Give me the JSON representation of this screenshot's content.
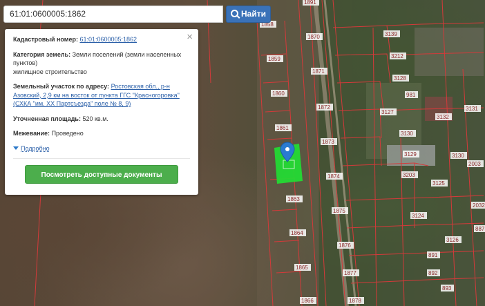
{
  "search": {
    "value": "61:01:0600005:1862",
    "button_label": "Найти"
  },
  "info_panel": {
    "cadastral": {
      "label": "Кадастровый номер:",
      "value": "61:01:0600005:1862"
    },
    "category": {
      "label": "Категория земель:",
      "value": "Земли поселений (земли населенных пунктов)",
      "use": "жилищное строительство"
    },
    "address": {
      "label": "Земельный участок по адресу:",
      "value": "Ростовская обл., р-н Азовский, 2,9 км на восток от пункта ГГС \"Красногоровка\" (СХКА \"им. XX Партсъезда\" поле № 8, 9)"
    },
    "area": {
      "label": "Уточненная площадь:",
      "value": "520 кв.м."
    },
    "survey": {
      "label": "Межевание:",
      "value": "Проведено"
    },
    "more_label": "Подробно",
    "docs_button": "Посмотреть доступные документы"
  },
  "map": {
    "selected_color": "#22dd33",
    "marker_color": "#2a7bd0",
    "plot_labels": [
      "1891",
      "1858",
      "1859",
      "1860",
      "1861",
      "1863",
      "1864",
      "1865",
      "1866",
      "1870",
      "1871",
      "1872",
      "1873",
      "1874",
      "1875",
      "1876",
      "1877",
      "1878",
      "3139",
      "3212",
      "3128",
      "981",
      "3127",
      "3130",
      "3129",
      "3203",
      "3124",
      "3132",
      "3131",
      "3130",
      "3125",
      "3126",
      "2003",
      "2032",
      "887",
      "891",
      "892",
      "893"
    ]
  }
}
